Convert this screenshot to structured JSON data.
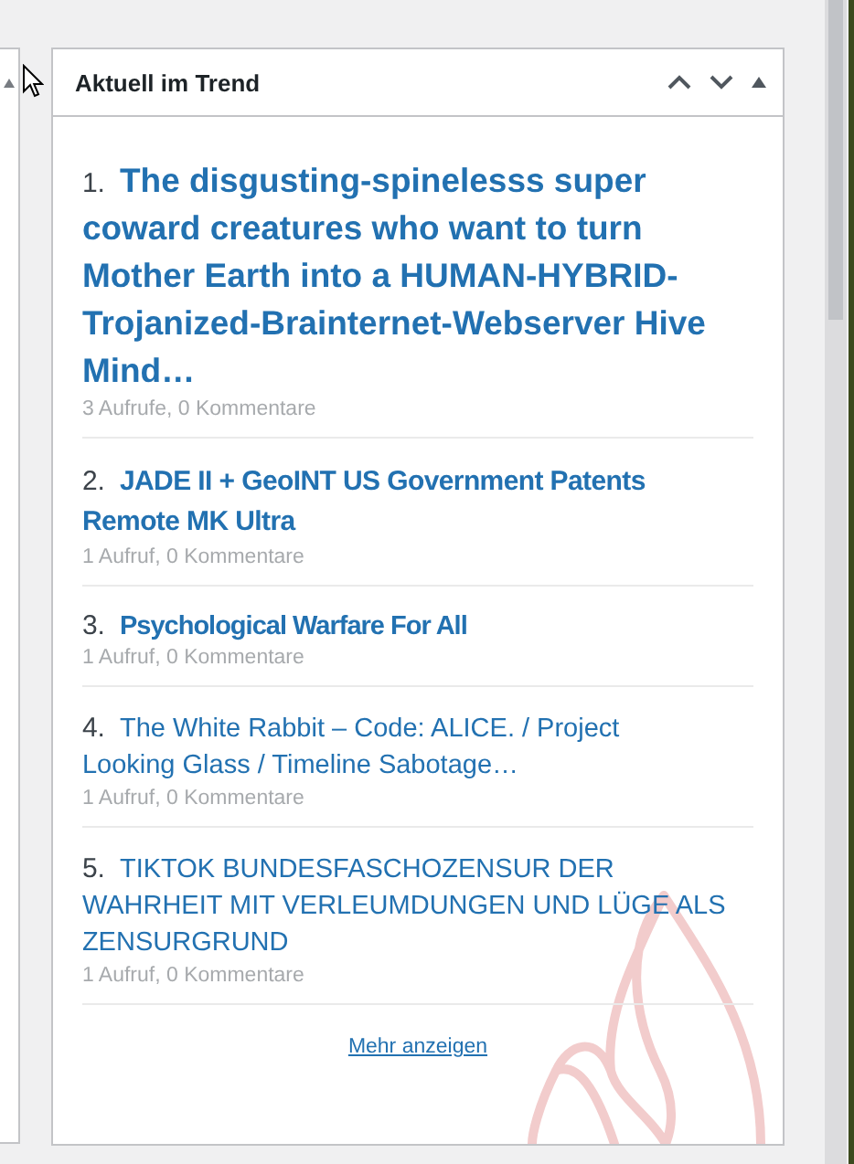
{
  "widget": {
    "title": "Aktuell im Trend",
    "more_link": "Mehr anzeigen"
  },
  "items": [
    {
      "number": "1.",
      "title": "The disgusting-spinelesss super coward creatures who want to turn Mother Earth into a HUMAN-HYBRID-Trojanized-Brainternet-Webserver Hive Mind…",
      "meta": "3 Aufrufe, 0 Kommentare"
    },
    {
      "number": "2.",
      "title": "JADE II + GeoINT US Government Patents Remote MK Ultra",
      "meta": "1 Aufruf, 0 Kommentare"
    },
    {
      "number": "3.",
      "title": "Psychological Warfare For All",
      "meta": "1 Aufruf, 0 Kommentare"
    },
    {
      "number": "4.",
      "title": "The White Rabbit – Code: ALICE. / Project Looking Glass / Timeline Sabotage…",
      "meta": "1 Aufruf, 0 Kommentare"
    },
    {
      "number": "5.",
      "title": "TIKTOK BUNDESFASCHOZENSUR DER WAHRHEIT MIT VERLEUMDUNGEN UND LÜGE ALS ZENSURGRUND",
      "meta": "1 Aufruf, 0 Kommentare"
    }
  ]
}
